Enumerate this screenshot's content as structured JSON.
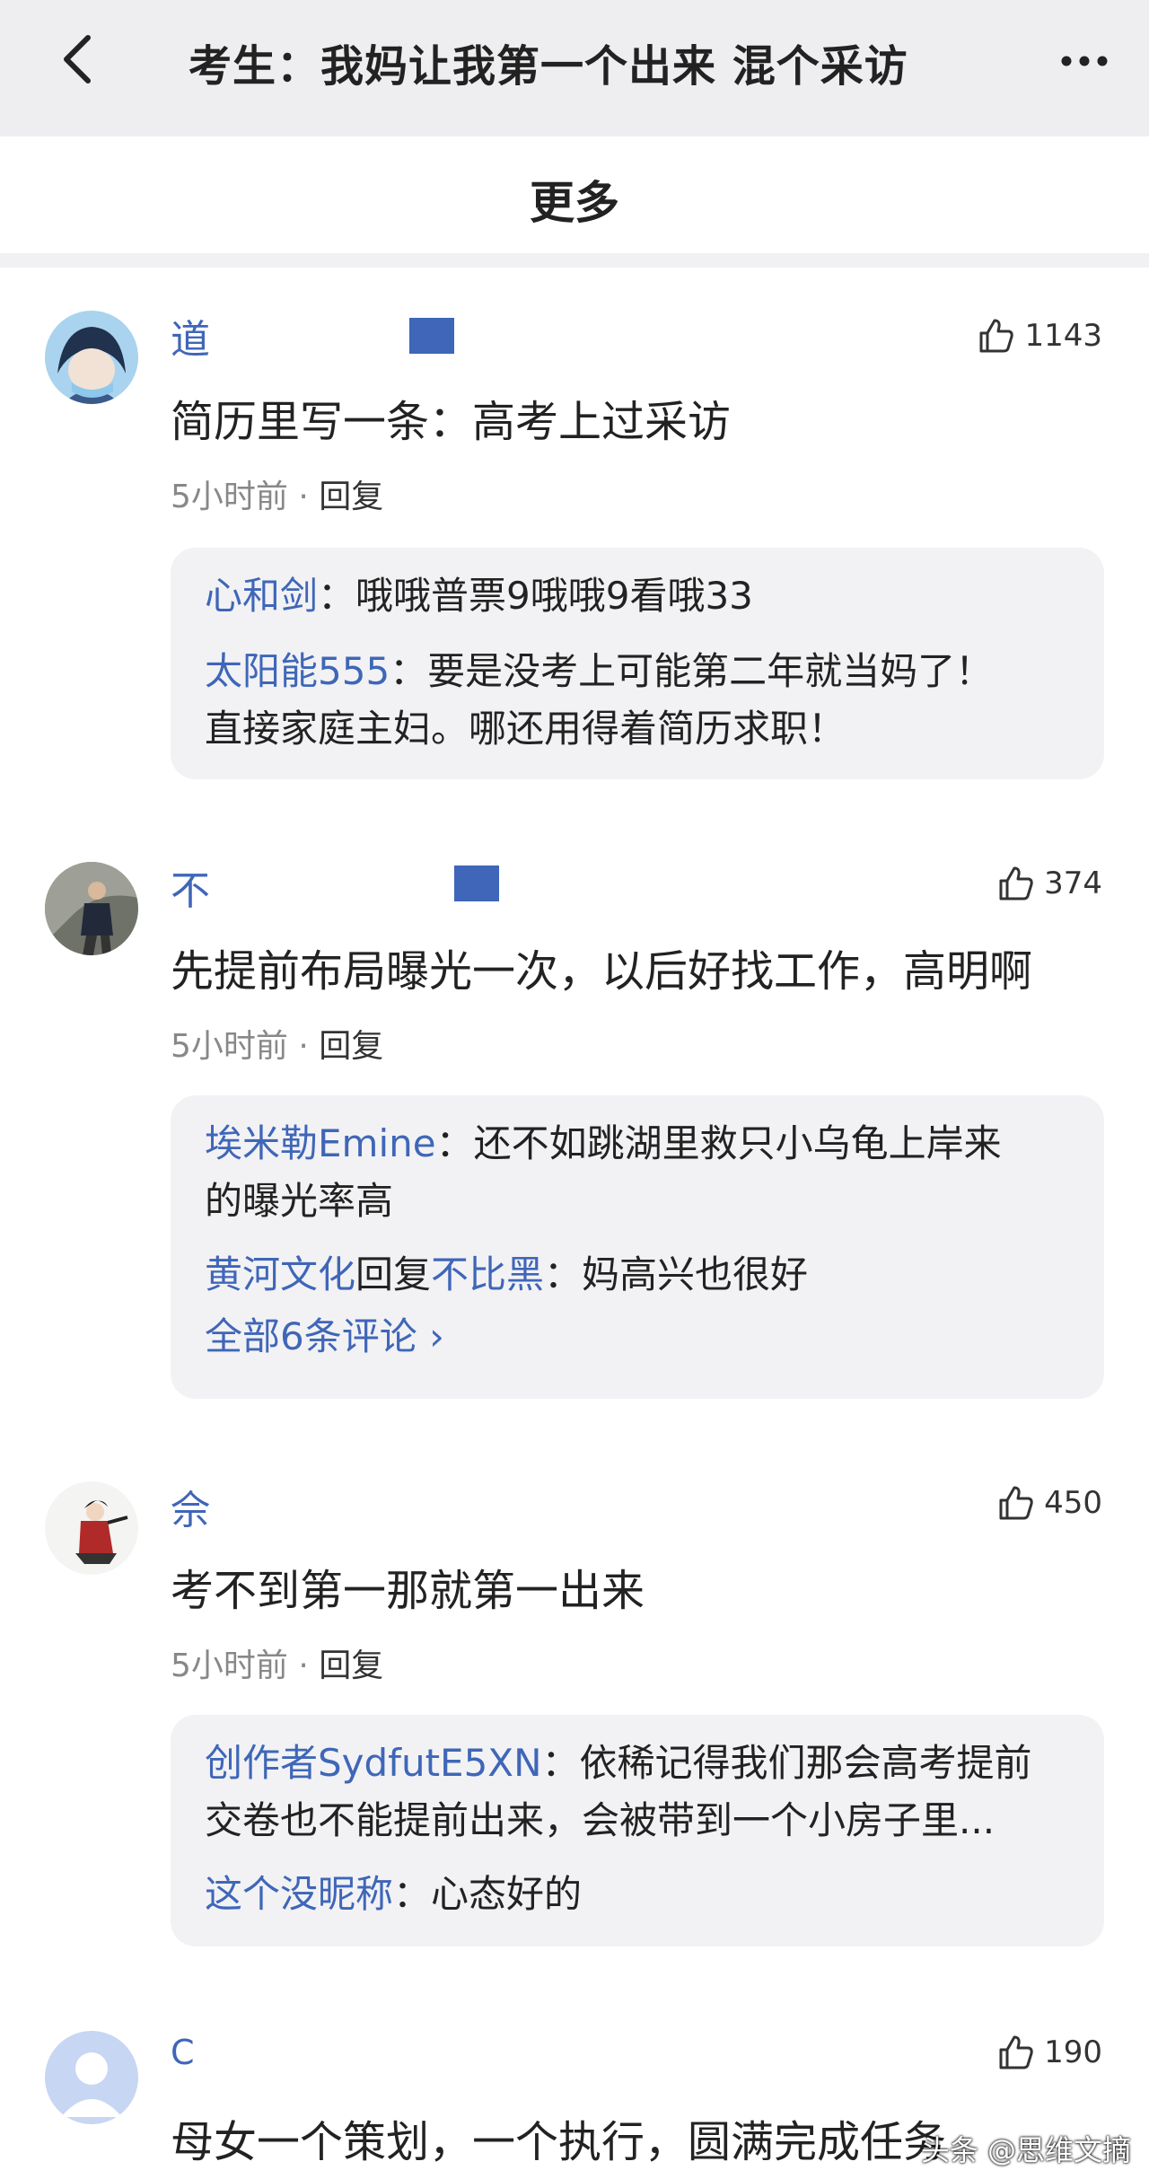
{
  "header": {
    "title": "考生：我妈让我第一个出来 混个采访"
  },
  "tab": {
    "label": "更多"
  },
  "comments": [
    {
      "username": "道",
      "likes": "1143",
      "text": "简历里写一条：高考上过采访",
      "time": "5小时前",
      "reply_label": "回复",
      "replies": [
        {
          "name": "心和剑",
          "text": "：哦哦普票9哦哦9看哦33"
        },
        {
          "name": "太阳能555",
          "text": "：要是没考上可能第二年就当妈了！",
          "cont": "直接家庭主妇。哪还用得着简历求职！"
        }
      ]
    },
    {
      "username": "不",
      "likes": "374",
      "text": "先提前布局曝光一次，以后好找工作，高明啊",
      "time": "5小时前",
      "reply_label": "回复",
      "replies": [
        {
          "name": "埃米勒Emine",
          "text": "：还不如跳湖里救只小乌龟上岸来",
          "cont": "的曝光率高"
        },
        {
          "name": "黄河文化",
          "mid": "回复",
          "name2": "不比黑",
          "text": "：妈高兴也很好"
        }
      ],
      "all_replies": "全部6条评论 ›"
    },
    {
      "username": "佘",
      "likes": "450",
      "text": "考不到第一那就第一出来",
      "time": "5小时前",
      "reply_label": "回复",
      "replies": [
        {
          "name": "创作者SydfutE5XN",
          "text": "：依稀记得我们那会高考提前",
          "cont": "交卷也不能提前出来，会被带到一个小房子里..."
        },
        {
          "name": "这个没昵称",
          "text": "：心态好的"
        }
      ]
    },
    {
      "username": "C",
      "likes": "190",
      "text": "母女一个策划，一个执行，圆满完成任务"
    }
  ],
  "watermark": "头条 @思维文摘",
  "colors": {
    "link": "#3f66b8",
    "header_bg": "#eeeef0",
    "reply_bg": "#f2f2f4"
  }
}
